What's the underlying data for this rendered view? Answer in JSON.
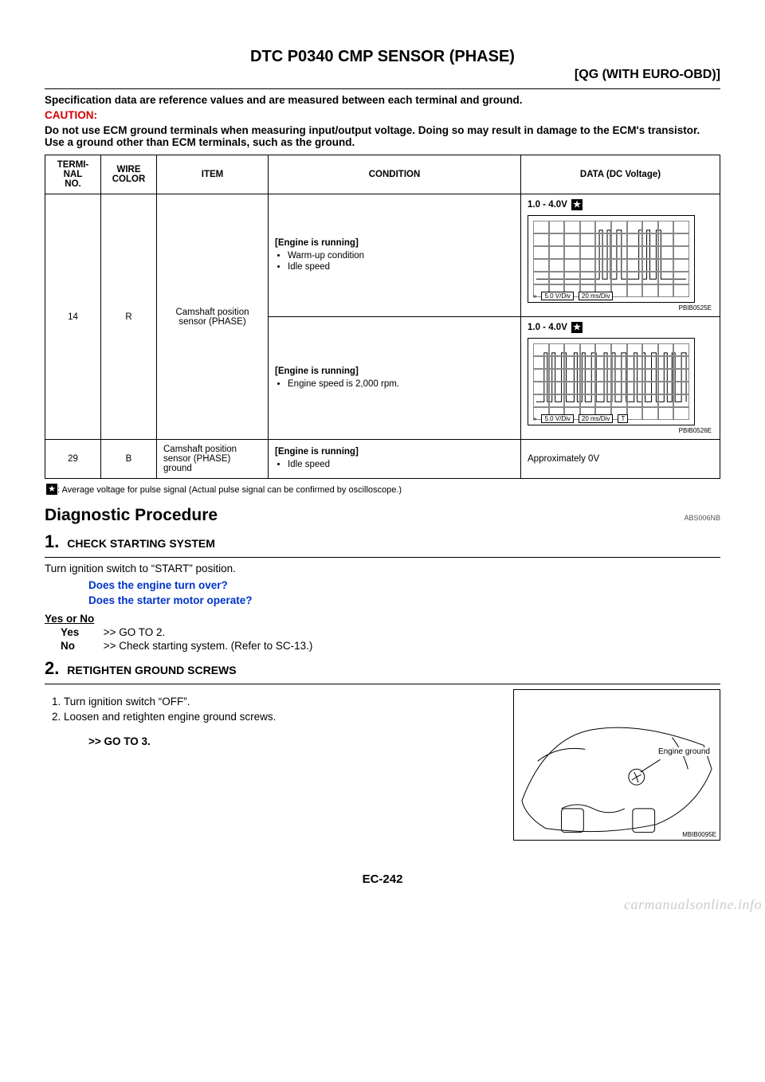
{
  "header": {
    "title": "DTC P0340 CMP SENSOR (PHASE)",
    "subsystem": "[QG (WITH EURO-OBD)]"
  },
  "intro": {
    "line1": "Specification data are reference values and are measured between each terminal and ground.",
    "caution_label": "CAUTION:",
    "caution_text": "Do not use ECM ground terminals when measuring input/output voltage. Doing so may result in damage to the ECM's transistor. Use a ground other than ECM terminals, such as the ground."
  },
  "table": {
    "headers": {
      "terminal": "TERMI-\nNAL\nNO.",
      "wire": "WIRE\nCOLOR",
      "item": "ITEM",
      "condition": "CONDITION",
      "data": "DATA (DC Voltage)"
    },
    "row1": {
      "terminal": "14",
      "wire": "R",
      "item": "Camshaft position sensor (PHASE)",
      "cond_a_head": "[Engine is running]",
      "cond_a_b1": "Warm-up condition",
      "cond_a_b2": "Idle speed",
      "data_a_label": "1.0 - 4.0V",
      "data_a_footer1": "5.0 V/Div",
      "data_a_footer2": "20 ms/Div",
      "data_a_code": "PBIB0525E",
      "cond_b_head": "[Engine is running]",
      "cond_b_b1": "Engine speed is 2,000 rpm.",
      "data_b_label": "1.0 - 4.0V",
      "data_b_footer1": "5.0 V/Div",
      "data_b_footer2": "20 ms/Div",
      "data_b_footer3": "T",
      "data_b_code": "PBIB0526E"
    },
    "row2": {
      "terminal": "29",
      "wire": "B",
      "item": "Camshaft position sensor (PHASE) ground",
      "cond_head": "[Engine is running]",
      "cond_b1": "Idle speed",
      "data": "Approximately 0V"
    },
    "footnote": ": Average voltage for pulse signal (Actual pulse signal can be confirmed by oscilloscope.)"
  },
  "section": {
    "title": "Diagnostic Procedure",
    "refcode": "ABS006NB"
  },
  "step1": {
    "num": "1.",
    "title": "CHECK STARTING SYSTEM",
    "body": "Turn ignition switch to “START” position.",
    "q1": "Does the engine turn over?",
    "q2": "Does the starter motor operate?",
    "yn_head": "Yes or No",
    "yes_lbl": "Yes",
    "yes_act": ">> GO TO 2.",
    "no_lbl": "No",
    "no_act": ">> Check starting system. (Refer to SC-13.)"
  },
  "step2": {
    "num": "2.",
    "title": "RETIGHTEN GROUND SCREWS",
    "li1": "Turn ignition switch “OFF”.",
    "li2": "Loosen and retighten engine ground screws.",
    "goto": ">> GO TO 3.",
    "illus_callout": "Engine ground",
    "illus_code": "MBIB0095E"
  },
  "footer": {
    "pagenum": "EC-242",
    "watermark": "carmanualsonline.info"
  }
}
